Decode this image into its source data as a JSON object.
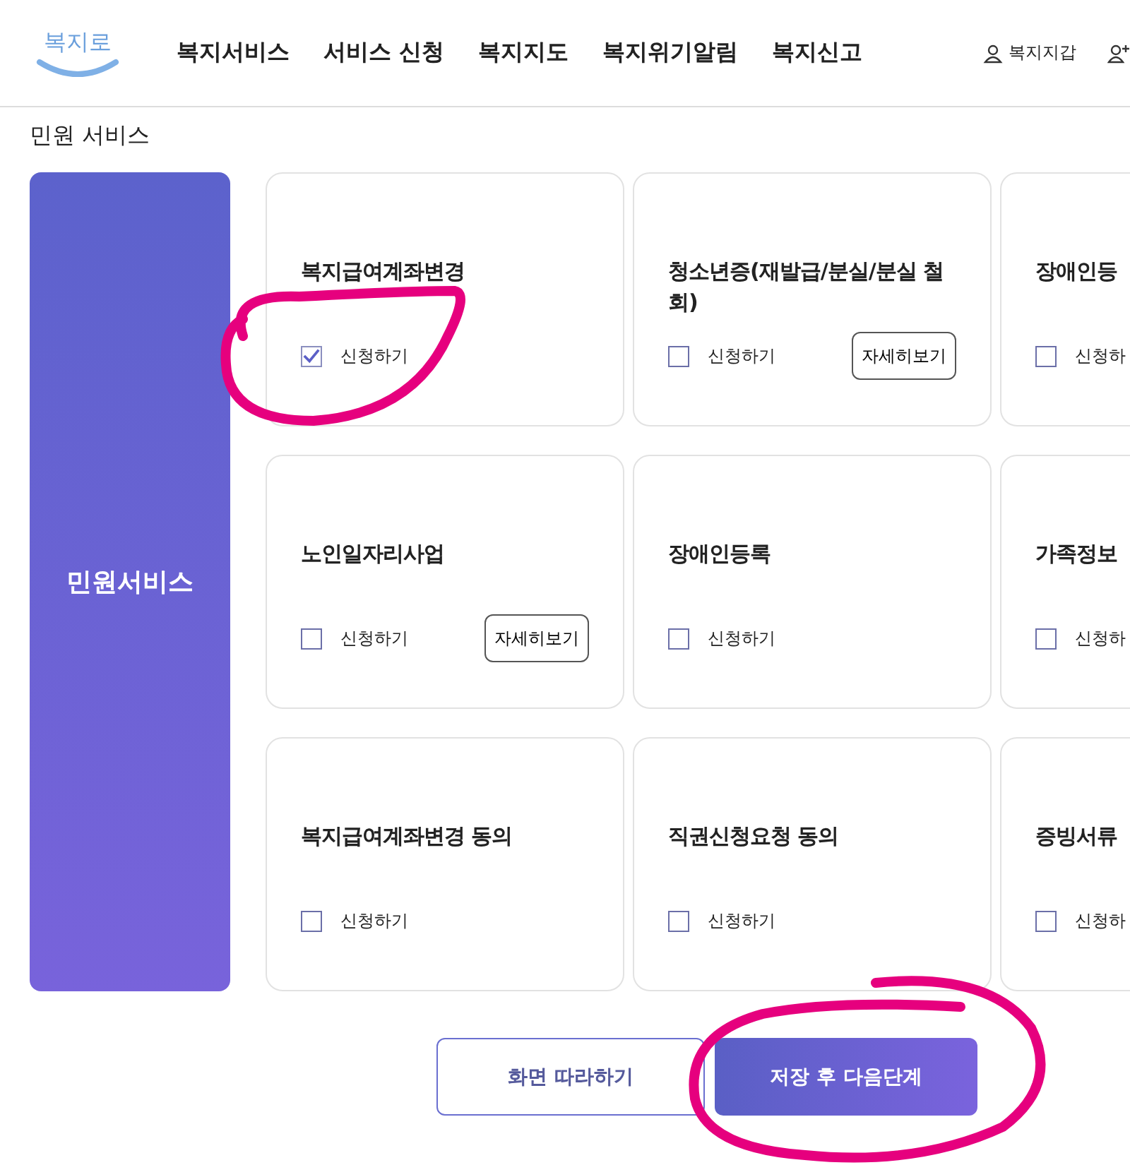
{
  "header": {
    "logo": "복지로",
    "nav": [
      "복지서비스",
      "서비스 신청",
      "복지지도",
      "복지위기알림",
      "복지신고"
    ],
    "wallet": "복지지갑"
  },
  "section_title": "민원 서비스",
  "sidebar": {
    "label": "민원서비스"
  },
  "cards": [
    {
      "title": "복지급여계좌변경",
      "checkbox_label": "신청하기",
      "checked": true
    },
    {
      "title": "청소년증(재발급/분실/분실 철회)",
      "checkbox_label": "신청하기",
      "checked": false,
      "detail_button": "자세히보기"
    },
    {
      "title": "장애인등",
      "checkbox_label": "신청하",
      "checked": false
    },
    {
      "title": "노인일자리사업",
      "checkbox_label": "신청하기",
      "checked": false,
      "detail_button": "자세히보기"
    },
    {
      "title": "장애인등록",
      "checkbox_label": "신청하기",
      "checked": false
    },
    {
      "title": "가족정보",
      "checkbox_label": "신청하",
      "checked": false
    },
    {
      "title": "복지급여계좌변경 동의",
      "checkbox_label": "신청하기",
      "checked": false
    },
    {
      "title": "직권신청요청 동의",
      "checkbox_label": "신청하기",
      "checked": false
    },
    {
      "title": "증빙서류",
      "checkbox_label": "신청하",
      "checked": false
    }
  ],
  "buttons": {
    "secondary": "화면 따라하기",
    "primary": "저장 후 다음단계"
  }
}
